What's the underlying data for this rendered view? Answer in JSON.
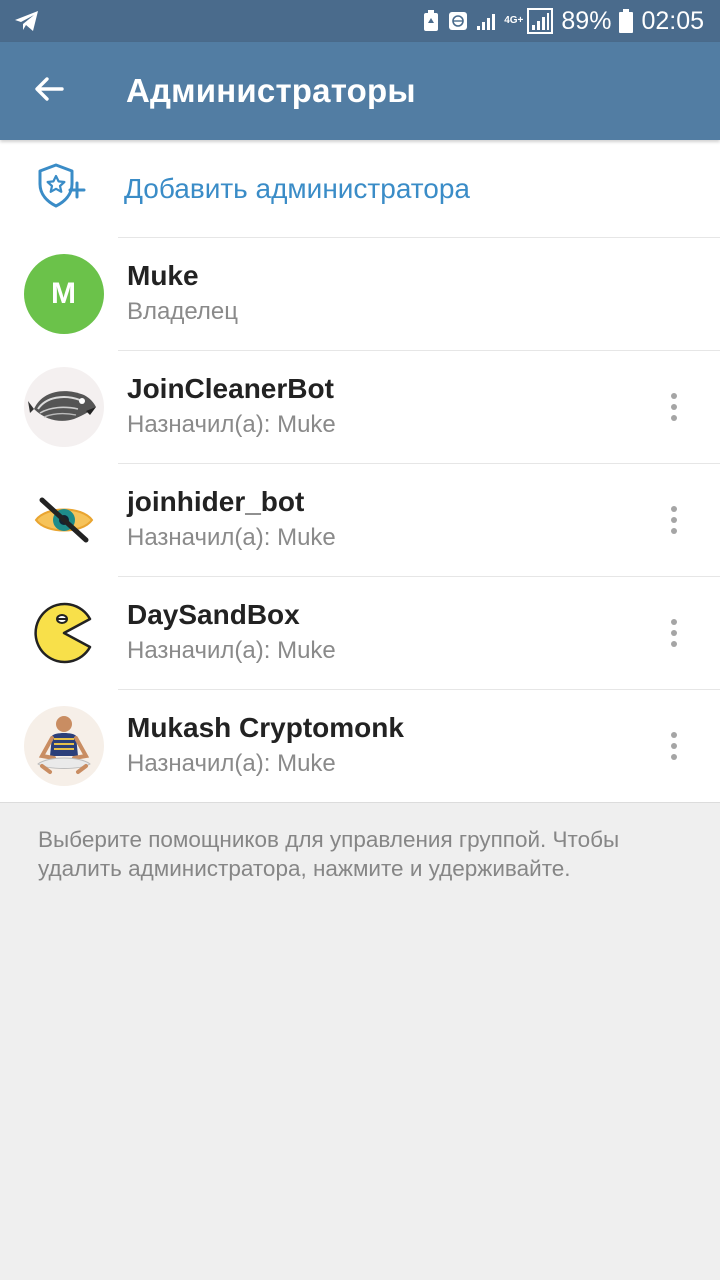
{
  "status_bar": {
    "app_icon": "telegram-icon",
    "network_label": "4G+",
    "battery_percent": "89%",
    "time": "02:05"
  },
  "app_bar": {
    "back_icon": "arrow-left-icon",
    "title": "Администраторы"
  },
  "add_admin": {
    "icon": "shield-star-plus-icon",
    "label": "Добавить администратора",
    "color": "#3a8cc7"
  },
  "admins": [
    {
      "name": "Muke",
      "subtitle": "Владелец",
      "avatar_letter": "M",
      "avatar_color": "#6bc24a"
    },
    {
      "name": "JoinCleanerBot",
      "subtitle": "Назначил(а): Muke",
      "avatar": "fish-avatar"
    },
    {
      "name": "joinhider_bot",
      "subtitle": "Назначил(а): Muke",
      "avatar": "crossed-eye-avatar"
    },
    {
      "name": "DaySandBox",
      "subtitle": "Назначил(а): Muke",
      "avatar": "pacman-avatar"
    },
    {
      "name": "Mukash Cryptomonk",
      "subtitle": "Назначил(а): Muke",
      "avatar": "meditating-person-avatar"
    }
  ],
  "footer_text": "Выберите помощников для управления группой. Чтобы удалить администратора, нажмите и удерживайте.",
  "colors": {
    "status_bar": "#4a6b8c",
    "app_bar": "#527da3",
    "accent": "#3a8cc7",
    "background": "#efefef"
  }
}
